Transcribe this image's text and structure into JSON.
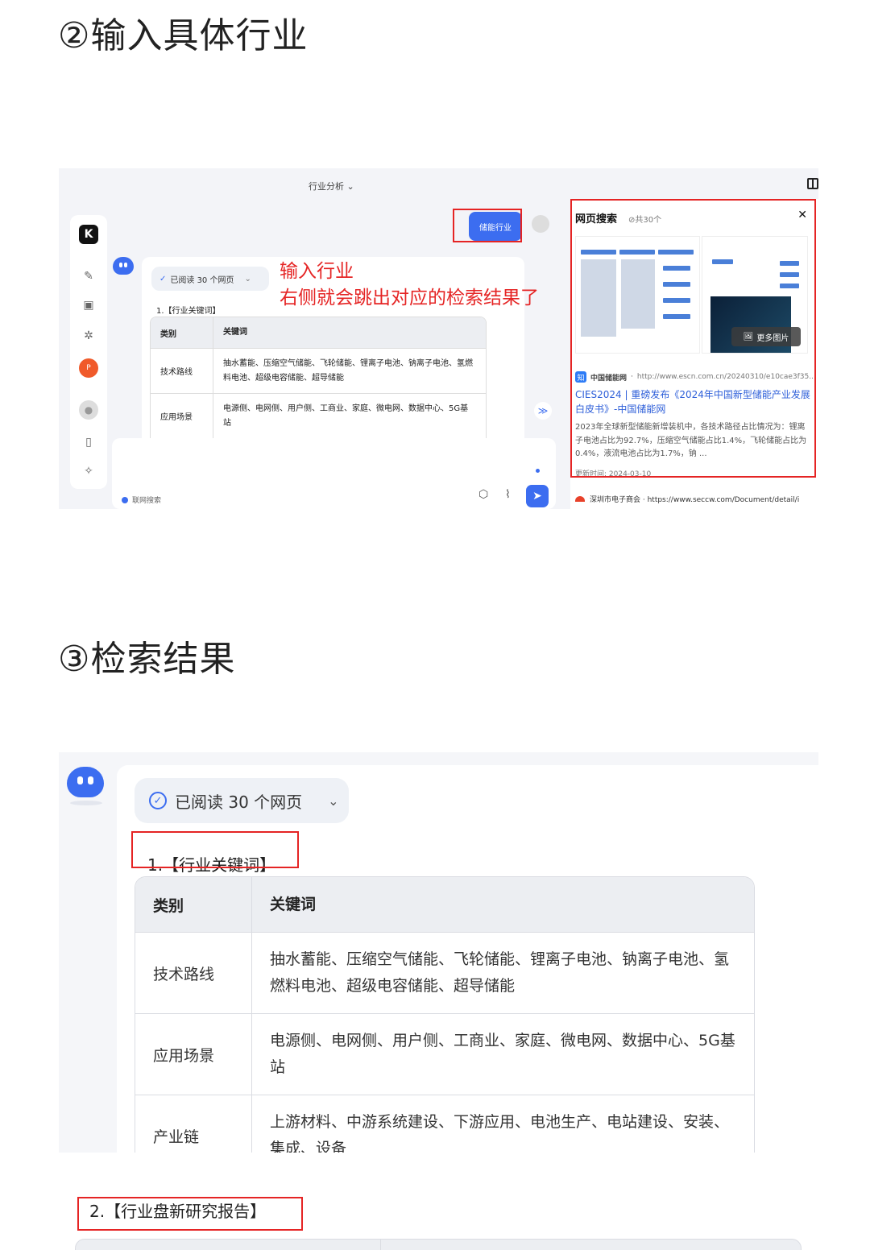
{
  "step2_heading": "②输入具体行业",
  "step3_heading": "③检索结果",
  "shot1": {
    "window_title": "行业分析",
    "read_pill": "已阅读 30 个网页",
    "section_label": "1.【行业关键词】",
    "user_message": "储能行业",
    "annotation_line1": "输入行业",
    "annotation_line2": "右侧就会跳出对应的检索结果了",
    "table": {
      "headers": [
        "类别",
        "关键词"
      ],
      "rows": [
        [
          "技术路线",
          "抽水蓄能、压缩空气储能、飞轮储能、锂离子电池、钠离子电池、氢燃料电池、超级电容储能、超导储能"
        ],
        [
          "应用场景",
          "电源侧、电网侧、用户侧、工商业、家庭、微电网、数据中心、5G基站"
        ]
      ]
    },
    "input_toggle": "联网搜索",
    "panel": {
      "title": "网页搜索",
      "count": "共30个",
      "more_images": "更多图片",
      "result": {
        "source": "中国储能网",
        "url": "http://www.escn.com.cn/20240310/e10cae3f35...",
        "title": "CIES2024 | 重磅发布《2024年中国新型储能产业发展白皮书》-中国储能网",
        "snippet": "2023年全球新型储能新增装机中，各技术路径占比情况为：锂离子电池占比为92.7%，压缩空气储能占比1.4%，飞轮储能占比为0.4%，液流电池占比为1.7%，钠 ...",
        "date": "更新时间: 2024-03-10"
      },
      "next_result": "深圳市电子商会 · https://www.seccw.com/Document/detail/i"
    }
  },
  "shot2": {
    "read_pill": "已阅读 30 个网页",
    "section_label": "1.【行业关键词】",
    "table": {
      "headers": [
        "类别",
        "关键词"
      ],
      "rows": [
        [
          "技术路线",
          "抽水蓄能、压缩空气储能、飞轮储能、锂离子电池、钠离子电池、氢燃料电池、超级电容储能、超导储能"
        ],
        [
          "应用场景",
          "电源侧、电网侧、用户侧、工商业、家庭、微电网、数据中心、5G基站"
        ],
        [
          "产业链",
          "上游材料、中游系统建设、下游应用、电池生产、电站建设、安装、集成、设备"
        ]
      ]
    }
  },
  "shot3": {
    "section_label": "2.【行业盘新研究报告】"
  },
  "colors": {
    "accent_blue": "#3c6df0",
    "annotation_red": "#e52424",
    "link_blue": "#2e5fd9"
  }
}
